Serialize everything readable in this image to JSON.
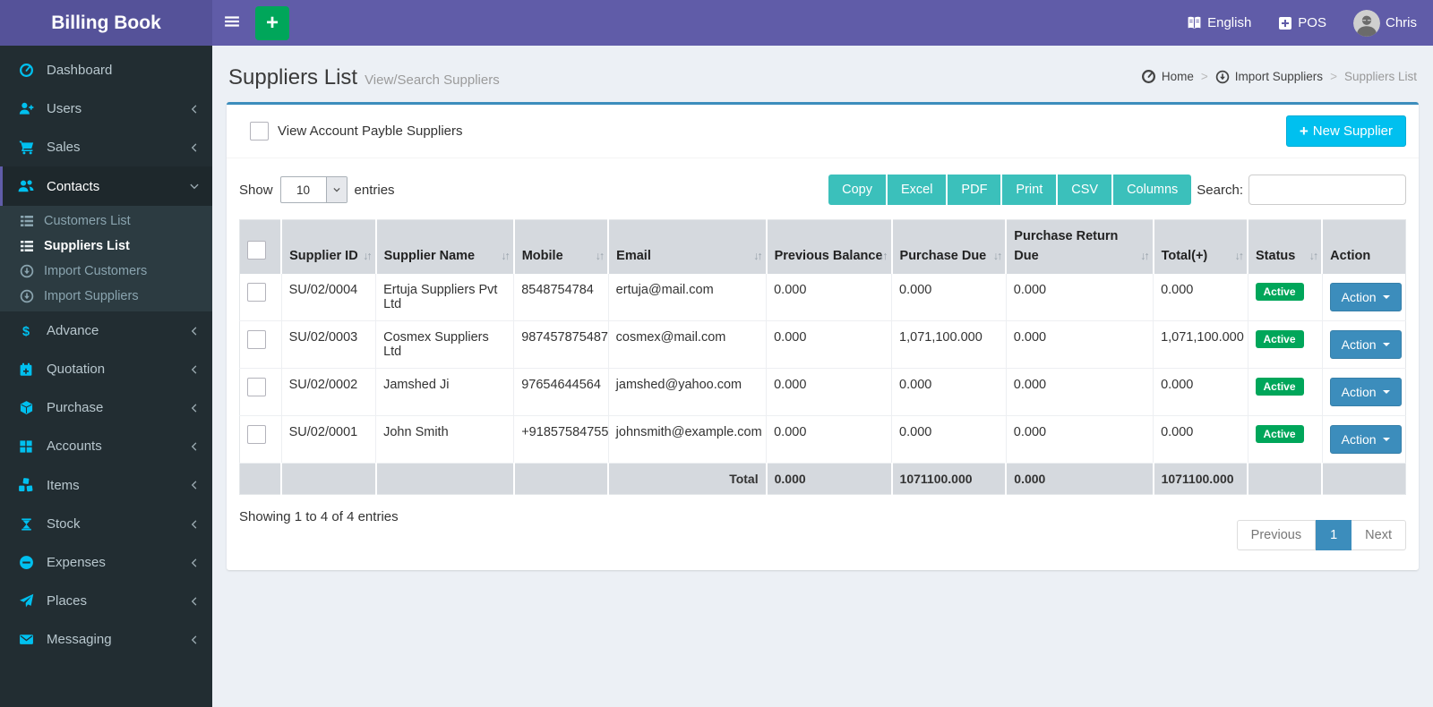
{
  "app": {
    "title": "Billing Book"
  },
  "header": {
    "menu_icon": "bars",
    "quick_add_icon": "plus",
    "language": {
      "label": "English",
      "icon": "book"
    },
    "pos": {
      "label": "POS",
      "icon": "plus-square"
    },
    "user": {
      "name": "Chris",
      "icon": "avatar"
    }
  },
  "sidebar": {
    "items": [
      {
        "label": "Dashboard",
        "icon": "dashboard"
      },
      {
        "label": "Users",
        "icon": "user-plus",
        "arrow": "left"
      },
      {
        "label": "Sales",
        "icon": "cart",
        "arrow": "left"
      },
      {
        "label": "Contacts",
        "icon": "users",
        "arrow": "down",
        "active": true,
        "submenu": [
          {
            "label": "Customers List",
            "icon": "list"
          },
          {
            "label": "Suppliers List",
            "icon": "list",
            "active": true
          },
          {
            "label": "Import Customers",
            "icon": "import"
          },
          {
            "label": "Import Suppliers",
            "icon": "import"
          }
        ]
      },
      {
        "label": "Advance",
        "icon": "dollar",
        "arrow": "left"
      },
      {
        "label": "Quotation",
        "icon": "calendar-plus",
        "arrow": "left"
      },
      {
        "label": "Purchase",
        "icon": "cube",
        "arrow": "left"
      },
      {
        "label": "Accounts",
        "icon": "grid",
        "arrow": "left"
      },
      {
        "label": "Items",
        "icon": "boxes",
        "arrow": "left"
      },
      {
        "label": "Stock",
        "icon": "hourglass",
        "arrow": "left"
      },
      {
        "label": "Expenses",
        "icon": "minus-circle",
        "arrow": "left"
      },
      {
        "label": "Places",
        "icon": "paper-plane",
        "arrow": "left"
      },
      {
        "label": "Messaging",
        "icon": "envelope",
        "arrow": "left"
      }
    ]
  },
  "page": {
    "title": "Suppliers List",
    "subtitle": "View/Search Suppliers",
    "breadcrumb": [
      {
        "label": "Home",
        "icon": "dashboard"
      },
      {
        "label": "Import Suppliers",
        "icon": "import"
      },
      {
        "label": "Suppliers List",
        "current": true
      }
    ]
  },
  "toolbar": {
    "filter_label": "View Account Payble Suppliers",
    "new_supplier_label": "New Supplier",
    "new_supplier_icon": "plus"
  },
  "controls": {
    "show_label": "Show",
    "page_size": "10",
    "entries_label": "entries",
    "export_buttons": [
      "Copy",
      "Excel",
      "PDF",
      "Print",
      "CSV",
      "Columns"
    ],
    "search_label": "Search:",
    "search_value": ""
  },
  "table": {
    "columns": [
      {
        "key": "select",
        "label": "",
        "sortable": false
      },
      {
        "key": "supplier_id",
        "label": "Supplier ID",
        "sortable": true
      },
      {
        "key": "supplier_name",
        "label": "Supplier Name",
        "sortable": true
      },
      {
        "key": "mobile",
        "label": "Mobile",
        "sortable": true
      },
      {
        "key": "email",
        "label": "Email",
        "sortable": true
      },
      {
        "key": "previous_balance",
        "label": "Previous Balance",
        "sortable": true
      },
      {
        "key": "purchase_due",
        "label": "Purchase Due",
        "sortable": true
      },
      {
        "key": "purchase_return_due",
        "label": "Purchase Return Due",
        "sortable": true
      },
      {
        "key": "total_plus",
        "label": "Total(+)",
        "sortable": true
      },
      {
        "key": "status",
        "label": "Status",
        "sortable": true
      },
      {
        "key": "action",
        "label": "Action",
        "sortable": false
      }
    ],
    "rows": [
      {
        "supplier_id": "SU/02/0004",
        "supplier_name": "Ertuja Suppliers Pvt Ltd",
        "mobile": "8548754784",
        "email": "ertuja@mail.com",
        "previous_balance": "0.000",
        "purchase_due": "0.000",
        "purchase_return_due": "0.000",
        "total_plus": "0.000",
        "status": "Active",
        "action": "Action"
      },
      {
        "supplier_id": "SU/02/0003",
        "supplier_name": "Cosmex Suppliers Ltd",
        "mobile": "987457875487",
        "email": "cosmex@mail.com",
        "previous_balance": "0.000",
        "purchase_due": "1,071,100.000",
        "purchase_return_due": "0.000",
        "total_plus": "1,071,100.000",
        "status": "Active",
        "action": "Action"
      },
      {
        "supplier_id": "SU/02/0002",
        "supplier_name": "Jamshed Ji",
        "mobile": "97654644564",
        "email": "jamshed@yahoo.com",
        "previous_balance": "0.000",
        "purchase_due": "0.000",
        "purchase_return_due": "0.000",
        "total_plus": "0.000",
        "status": "Active",
        "action": "Action"
      },
      {
        "supplier_id": "SU/02/0001",
        "supplier_name": "John Smith",
        "mobile": "+91857584755",
        "email": "johnsmith@example.com",
        "previous_balance": "0.000",
        "purchase_due": "0.000",
        "purchase_return_due": "0.000",
        "total_plus": "0.000",
        "status": "Active",
        "action": "Action"
      }
    ],
    "total_row": {
      "label": "Total",
      "previous_balance": "0.000",
      "purchase_due": "1071100.000",
      "purchase_return_due": "0.000",
      "total_plus": "1071100.000"
    }
  },
  "footer": {
    "showing": "Showing 1 to 4 of 4 entries",
    "pagination": {
      "prev": "Previous",
      "current": "1",
      "next": "Next"
    }
  },
  "colors": {
    "navbar_purple": "#605ca8",
    "logo_purple": "#555299",
    "sidebar_dark": "#222d32",
    "submenu_dark": "#2c3b41",
    "accent_blue": "#3c8dbc",
    "info_cyan": "#00c0ef",
    "success_green": "#00a65a",
    "export_teal": "#3bc0bb",
    "content_bg": "#ecf0f5",
    "table_head_bg": "#d5d9de"
  }
}
